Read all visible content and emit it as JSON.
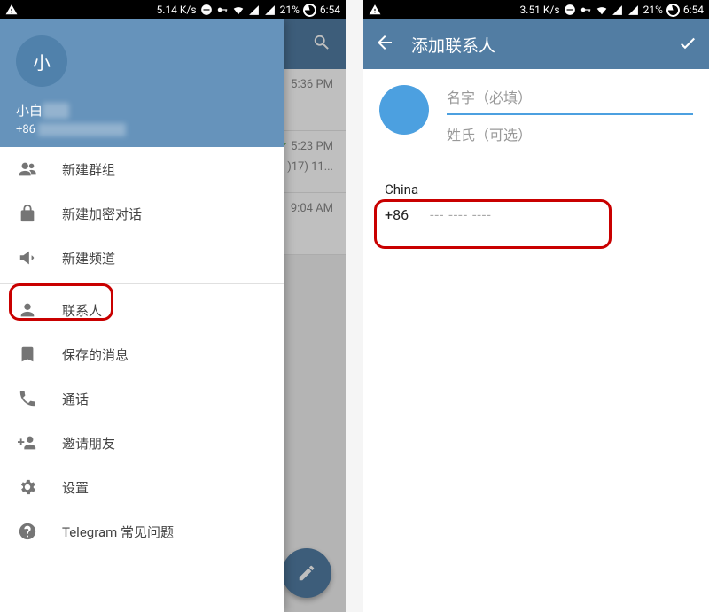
{
  "status": {
    "left_speed": "5.14 K/s",
    "right_speed": "3.51 K/s",
    "battery": "21%",
    "time": "6:54"
  },
  "left": {
    "chat_times": [
      "5:36 PM",
      "5:23 PM",
      "9:04 AM"
    ],
    "chat_preview": ")17) 11...",
    "drawer": {
      "avatar_text": "小",
      "name_prefix": "小白",
      "phone_prefix": "+86",
      "items": [
        {
          "icon": "group",
          "label": "新建群组"
        },
        {
          "icon": "lock",
          "label": "新建加密对话"
        },
        {
          "icon": "megaphone",
          "label": "新建频道"
        },
        {
          "icon": "contacts",
          "label": "联系人"
        },
        {
          "icon": "bookmark",
          "label": "保存的消息"
        },
        {
          "icon": "call",
          "label": "通话"
        },
        {
          "icon": "invite",
          "label": "邀请朋友"
        },
        {
          "icon": "settings",
          "label": "设置"
        },
        {
          "icon": "help",
          "label": "Telegram 常见问题"
        }
      ]
    }
  },
  "right": {
    "title": "添加联系人",
    "first_name_placeholder": "名字（必填）",
    "last_name_placeholder": "姓氏（可选）",
    "country": "China",
    "phone_code": "+86",
    "phone_placeholder": "--- ---- ----"
  }
}
